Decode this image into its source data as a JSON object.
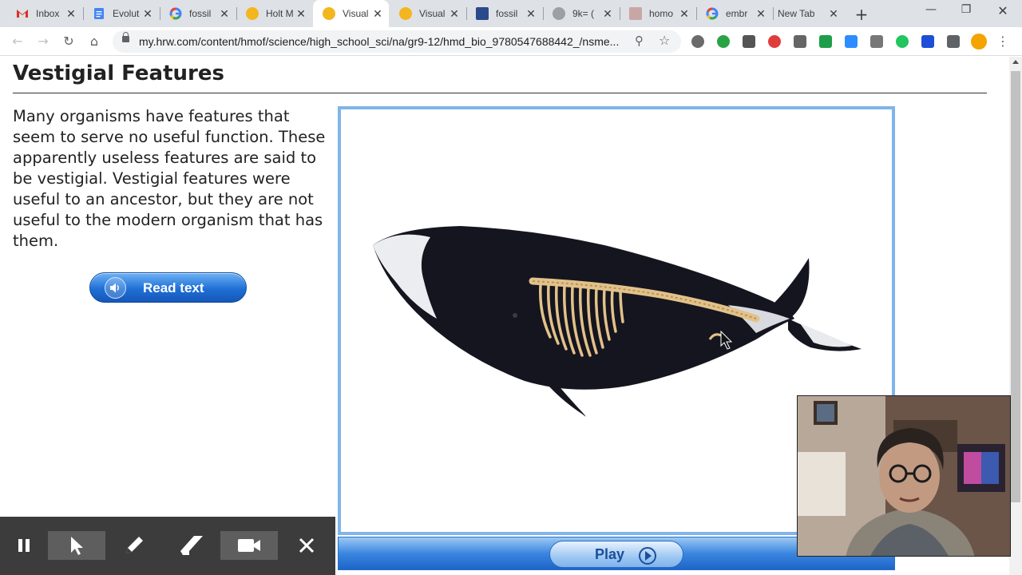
{
  "browser": {
    "tabs": [
      {
        "title": "Inbox",
        "icon": "gmail-icon",
        "active": false
      },
      {
        "title": "Evolut",
        "icon": "docs-icon",
        "active": false
      },
      {
        "title": "fossil",
        "icon": "google-icon",
        "active": false
      },
      {
        "title": "Holt M",
        "icon": "hmh-icon",
        "active": false
      },
      {
        "title": "Visual",
        "icon": "hmh-icon",
        "active": true
      },
      {
        "title": "Visual",
        "icon": "hmh-icon",
        "active": false
      },
      {
        "title": "fossil",
        "icon": "site-icon",
        "active": false
      },
      {
        "title": "9k= (",
        "icon": "globe-icon",
        "active": false
      },
      {
        "title": "homo",
        "icon": "site-icon",
        "active": false
      },
      {
        "title": "embr",
        "icon": "google-icon",
        "active": false
      },
      {
        "title": "New Tab",
        "icon": "",
        "active": false
      }
    ],
    "url": "my.hrw.com/content/hmof/science/high_school_sci/na/gr9-12/hmd_bio_9780547688442_/nsme...",
    "colors": {
      "tabstrip": "#dee1e6",
      "accent_blue": "#1f6fd6"
    }
  },
  "page": {
    "title": "Vestigial Features",
    "body": "Many organisms have features that seem to serve no useful function. These apparently useless features are said to be vestigial. Vestigial features were useful to an ancestor, but they are not useful to the modern organism that has them.",
    "read_button": "Read text",
    "play_button": "Play"
  },
  "annotation_toolbar": {
    "tools": [
      "pause-icon",
      "pointer-icon",
      "pen-icon",
      "eraser-icon",
      "camera-icon",
      "close-icon"
    ],
    "selected": "pointer-icon"
  }
}
